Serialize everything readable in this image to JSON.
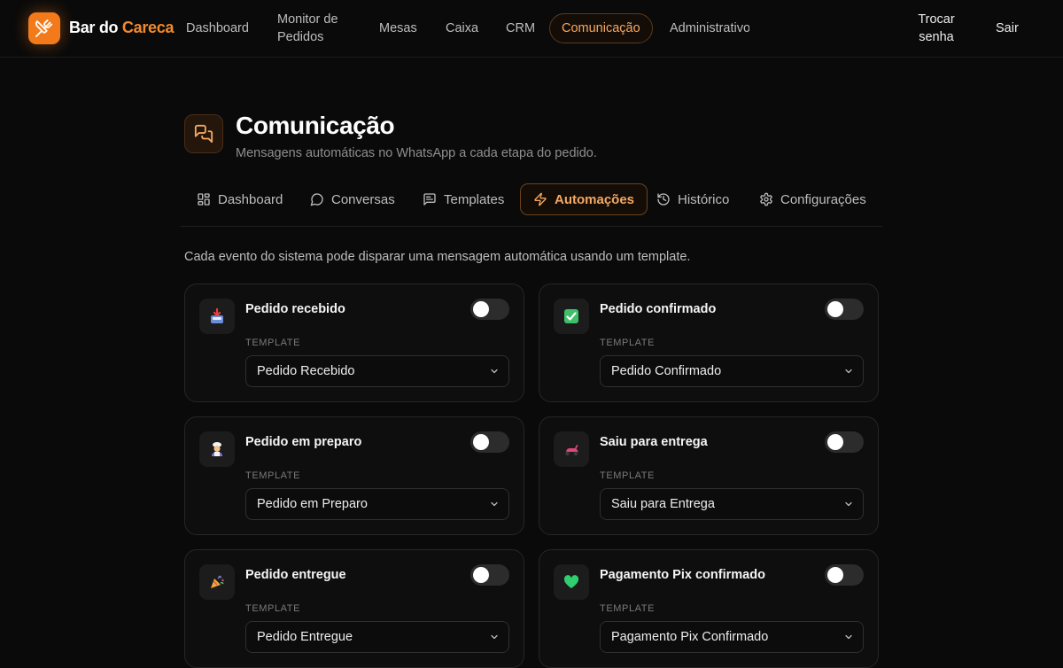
{
  "app": {
    "brand_part1": "Bar do",
    "brand_part2": "Careca",
    "accent_color": "#f27a1a",
    "logo_icon": "utensils-crossed-icon"
  },
  "nav": {
    "items": [
      {
        "label": "Dashboard"
      },
      {
        "label": "Monitor de Pedidos"
      },
      {
        "label": "Mesas"
      },
      {
        "label": "Caixa"
      },
      {
        "label": "CRM"
      },
      {
        "label": "Comunicação",
        "active": true
      },
      {
        "label": "Administrativo"
      }
    ],
    "change_password": "Trocar senha",
    "logout": "Sair"
  },
  "page": {
    "icon": "messages-square-icon",
    "title": "Comunicação",
    "subtitle": "Mensagens automáticas no WhatsApp a cada etapa do pedido."
  },
  "tabs": [
    {
      "label": "Dashboard",
      "icon": "layout-grid-icon"
    },
    {
      "label": "Conversas",
      "icon": "message-circle-icon"
    },
    {
      "label": "Templates",
      "icon": "message-square-text-icon"
    },
    {
      "label": "Automações",
      "icon": "zap-icon",
      "active": true
    },
    {
      "label": "Histórico",
      "icon": "history-icon"
    },
    {
      "label": "Configurações",
      "icon": "settings-icon"
    }
  ],
  "intro": "Cada evento do sistema pode disparar uma mensagem automática usando um template.",
  "template_label": "TEMPLATE",
  "automations": [
    {
      "title": "Pedido recebido",
      "emoji": "inbox-tray-emoji",
      "enabled": false,
      "template": "Pedido Recebido"
    },
    {
      "title": "Pedido confirmado",
      "emoji": "check-mark-button-emoji",
      "enabled": false,
      "template": "Pedido Confirmado"
    },
    {
      "title": "Pedido em preparo",
      "emoji": "cook-emoji",
      "enabled": false,
      "template": "Pedido em Preparo"
    },
    {
      "title": "Saiu para entrega",
      "emoji": "motor-scooter-emoji",
      "enabled": false,
      "template": "Saiu para Entrega"
    },
    {
      "title": "Pedido entregue",
      "emoji": "party-popper-emoji",
      "enabled": false,
      "template": "Pedido Entregue"
    },
    {
      "title": "Pagamento Pix confirmado",
      "emoji": "green-heart-emoji",
      "enabled": false,
      "template": "Pagamento Pix Confirmado"
    }
  ]
}
